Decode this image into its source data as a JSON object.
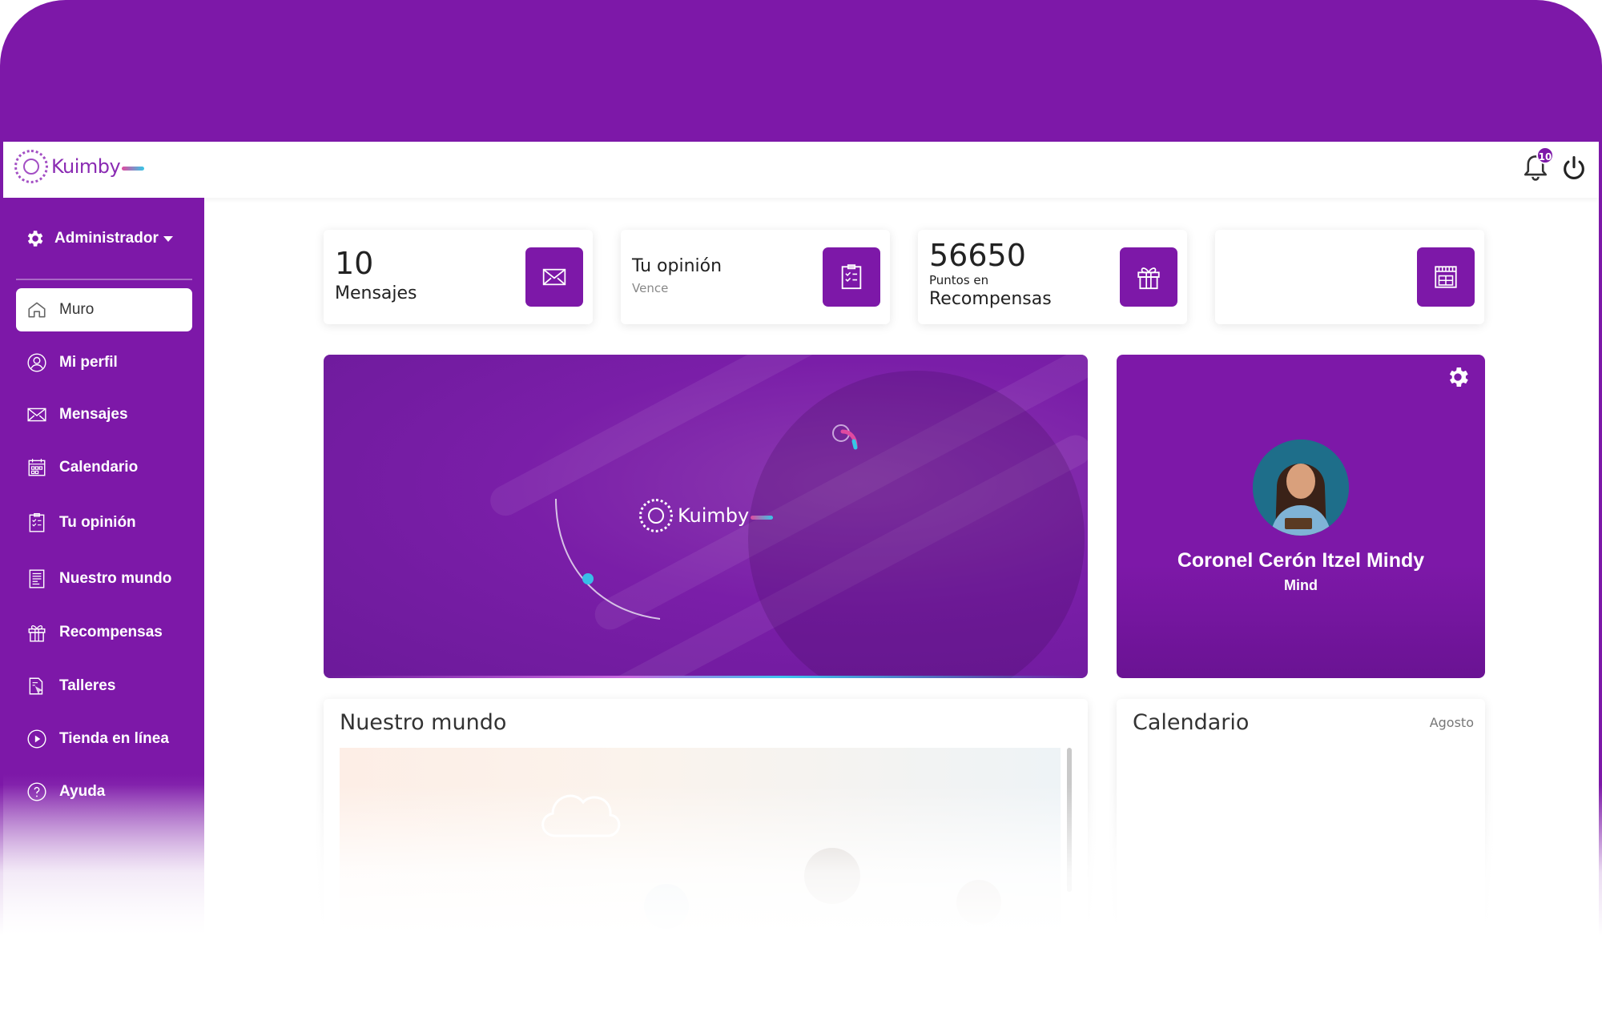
{
  "brand": {
    "name": "Kuimby",
    "accent": "#7d18a8"
  },
  "header": {
    "notification_count": "10"
  },
  "sidebar": {
    "role_label": "Administrador",
    "items": [
      {
        "label": "Muro",
        "icon": "home-icon"
      },
      {
        "label": "Mi perfil",
        "icon": "user-icon"
      },
      {
        "label": "Mensajes",
        "icon": "envelope-icon"
      },
      {
        "label": "Calendario",
        "icon": "calendar-icon"
      },
      {
        "label": "Tu opinión",
        "icon": "clipboard-icon"
      },
      {
        "label": "Nuestro mundo",
        "icon": "document-icon"
      },
      {
        "label": "Recompensas",
        "icon": "gift-icon"
      },
      {
        "label": "Talleres",
        "icon": "workshop-icon"
      },
      {
        "label": "Tienda en línea",
        "icon": "play-circle-icon"
      },
      {
        "label": "Ayuda",
        "icon": "help-icon"
      }
    ]
  },
  "stats": {
    "messages": {
      "count": "10",
      "label": "Mensajes",
      "icon": "envelope-icon"
    },
    "opinion": {
      "label": "Tu opinión",
      "sub": "Vence",
      "icon": "clipboard-icon"
    },
    "rewards": {
      "count": "56650",
      "small": "Puntos en",
      "label": "Recompensas",
      "icon": "gift-icon"
    },
    "store": {
      "icon": "store-icon"
    }
  },
  "hero": {
    "logo_text": "Kuimby"
  },
  "profile": {
    "name": "Coronel Cerón Itzel Mindy",
    "subtitle": "Mind"
  },
  "panels": {
    "world": {
      "title": "Nuestro mundo"
    },
    "calendar": {
      "title": "Calendario",
      "month": "Agosto"
    }
  }
}
